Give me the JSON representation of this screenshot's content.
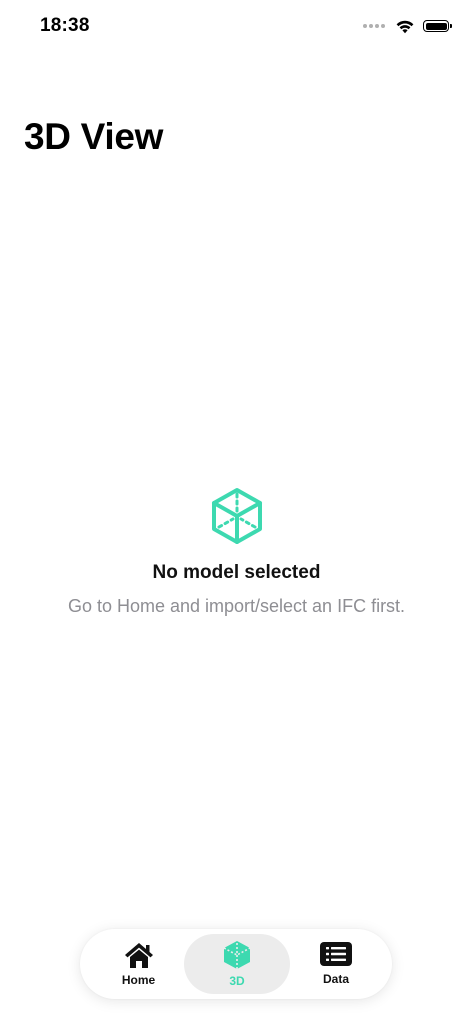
{
  "status_bar": {
    "time": "18:38",
    "signal_icon": "signal-dots-icon",
    "wifi_icon": "wifi-icon",
    "battery_icon": "battery-full-icon"
  },
  "page": {
    "title": "3D View"
  },
  "empty_state": {
    "icon": "cube-icon",
    "title": "No model selected",
    "subtitle": "Go to Home and import/select an IFC first."
  },
  "tab_bar": {
    "selected": "3D",
    "tabs": [
      {
        "label": "Home",
        "icon": "house-icon"
      },
      {
        "label": "3D",
        "icon": "cube-icon"
      },
      {
        "label": "Data",
        "icon": "list-icon"
      }
    ]
  },
  "colors": {
    "accent": "#3dd9b0",
    "text_primary": "#111111",
    "text_secondary": "#8e8e93",
    "selected_tab_bg": "#ececec",
    "background": "#ffffff"
  }
}
